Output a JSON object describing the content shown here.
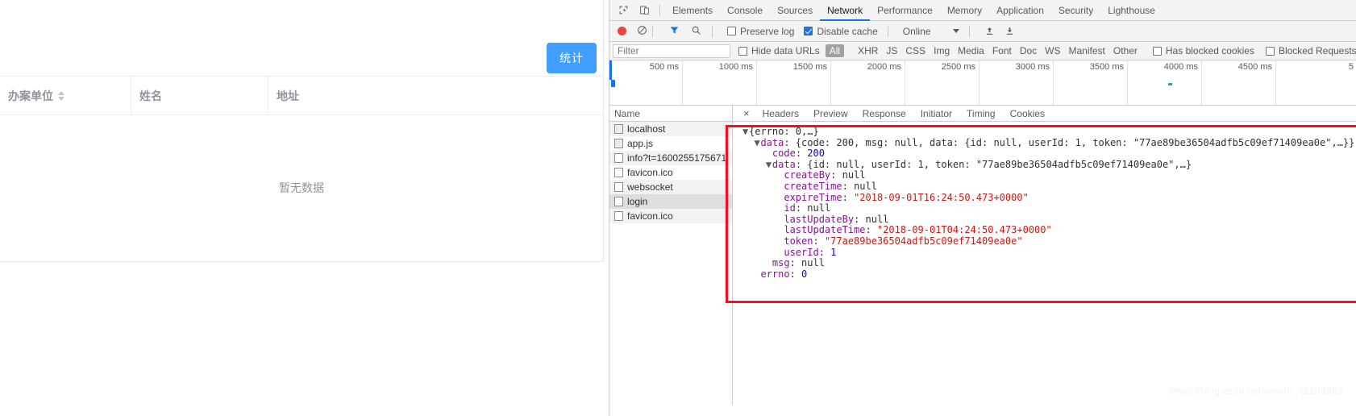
{
  "app": {
    "stat_button": "统计",
    "table": {
      "columns": [
        "办案单位",
        "姓名",
        "地址"
      ],
      "empty_text": "暂无数据"
    }
  },
  "devtools": {
    "tabs": [
      {
        "label": "Elements",
        "active": false
      },
      {
        "label": "Console",
        "active": false
      },
      {
        "label": "Sources",
        "active": false
      },
      {
        "label": "Network",
        "active": true
      },
      {
        "label": "Performance",
        "active": false
      },
      {
        "label": "Memory",
        "active": false
      },
      {
        "label": "Application",
        "active": false
      },
      {
        "label": "Security",
        "active": false
      },
      {
        "label": "Lighthouse",
        "active": false
      }
    ],
    "toolbar": {
      "preserve_log": {
        "label": "Preserve log",
        "checked": false
      },
      "disable_cache": {
        "label": "Disable cache",
        "checked": true
      },
      "throttle": "Online"
    },
    "filterbar": {
      "filter_placeholder": "Filter",
      "filter_value": "",
      "hide_data_urls": {
        "label": "Hide data URLs",
        "checked": false
      },
      "types": [
        "All",
        "XHR",
        "JS",
        "CSS",
        "Img",
        "Media",
        "Font",
        "Doc",
        "WS",
        "Manifest",
        "Other"
      ],
      "selected_type": "All",
      "has_blocked_cookies": {
        "label": "Has blocked cookies",
        "checked": false
      },
      "blocked_requests": {
        "label": "Blocked Requests",
        "checked": false
      }
    },
    "timeline": {
      "ticks": [
        "500 ms",
        "1000 ms",
        "1500 ms",
        "2000 ms",
        "2500 ms",
        "3000 ms",
        "3500 ms",
        "4000 ms",
        "4500 ms",
        "5"
      ]
    },
    "requests": {
      "header": "Name",
      "items": [
        {
          "name": "localhost",
          "selected": false,
          "icon": "document-filled-icon"
        },
        {
          "name": "app.js",
          "selected": false,
          "icon": "document-filled-icon"
        },
        {
          "name": "info?t=1600255175671",
          "selected": false,
          "icon": "document-icon"
        },
        {
          "name": "favicon.ico",
          "selected": false,
          "icon": "document-icon"
        },
        {
          "name": "websocket",
          "selected": false,
          "icon": "document-icon"
        },
        {
          "name": "login",
          "selected": true,
          "icon": "document-icon"
        },
        {
          "name": "favicon.ico",
          "selected": false,
          "icon": "document-icon"
        }
      ]
    },
    "detail": {
      "close_label": "×",
      "tabs": [
        {
          "label": "Headers",
          "active": false
        },
        {
          "label": "Preview",
          "active": true
        },
        {
          "label": "Response",
          "active": false
        },
        {
          "label": "Initiator",
          "active": false
        },
        {
          "label": "Timing",
          "active": false
        },
        {
          "label": "Cookies",
          "active": false
        }
      ],
      "preview_lines": [
        {
          "indent": 0,
          "arrow": "▼",
          "segments": [
            {
              "t": "{errno: 0,…}",
              "c": "plain"
            }
          ]
        },
        {
          "indent": 1,
          "arrow": "▼",
          "segments": [
            {
              "t": "data",
              "c": "k"
            },
            {
              "t": ": {code: 200, msg: null, data: {id: null, userId: 1, token: ",
              "c": "plain"
            },
            {
              "t": "\"77ae89be36504adfb5c09ef71409ea0e\"",
              "c": "plain"
            },
            {
              "t": ",…}}",
              "c": "plain"
            }
          ]
        },
        {
          "indent": 2,
          "arrow": "",
          "segments": [
            {
              "t": "code",
              "c": "k"
            },
            {
              "t": ": ",
              "c": "plain"
            },
            {
              "t": "200",
              "c": "num"
            }
          ]
        },
        {
          "indent": 2,
          "arrow": "▼",
          "segments": [
            {
              "t": "data",
              "c": "k"
            },
            {
              "t": ": {id: null, userId: 1, token: ",
              "c": "plain"
            },
            {
              "t": "\"77ae89be36504adfb5c09ef71409ea0e\"",
              "c": "plain"
            },
            {
              "t": ",…}",
              "c": "plain"
            }
          ]
        },
        {
          "indent": 3,
          "arrow": "",
          "segments": [
            {
              "t": "createBy",
              "c": "k"
            },
            {
              "t": ": ",
              "c": "plain"
            },
            {
              "t": "null",
              "c": "nul"
            }
          ]
        },
        {
          "indent": 3,
          "arrow": "",
          "segments": [
            {
              "t": "createTime",
              "c": "k"
            },
            {
              "t": ": ",
              "c": "plain"
            },
            {
              "t": "null",
              "c": "nul"
            }
          ]
        },
        {
          "indent": 3,
          "arrow": "",
          "segments": [
            {
              "t": "expireTime",
              "c": "k"
            },
            {
              "t": ": ",
              "c": "plain"
            },
            {
              "t": "\"2018-09-01T16:24:50.473+0000\"",
              "c": "str"
            }
          ]
        },
        {
          "indent": 3,
          "arrow": "",
          "segments": [
            {
              "t": "id",
              "c": "k"
            },
            {
              "t": ": ",
              "c": "plain"
            },
            {
              "t": "null",
              "c": "nul"
            }
          ]
        },
        {
          "indent": 3,
          "arrow": "",
          "segments": [
            {
              "t": "lastUpdateBy",
              "c": "k"
            },
            {
              "t": ": ",
              "c": "plain"
            },
            {
              "t": "null",
              "c": "nul"
            }
          ]
        },
        {
          "indent": 3,
          "arrow": "",
          "segments": [
            {
              "t": "lastUpdateTime",
              "c": "k"
            },
            {
              "t": ": ",
              "c": "plain"
            },
            {
              "t": "\"2018-09-01T04:24:50.473+0000\"",
              "c": "str"
            }
          ]
        },
        {
          "indent": 3,
          "arrow": "",
          "segments": [
            {
              "t": "token",
              "c": "k"
            },
            {
              "t": ": ",
              "c": "plain"
            },
            {
              "t": "\"77ae89be36504adfb5c09ef71409ea0e\"",
              "c": "str"
            }
          ]
        },
        {
          "indent": 3,
          "arrow": "",
          "segments": [
            {
              "t": "userId",
              "c": "k"
            },
            {
              "t": ": ",
              "c": "plain"
            },
            {
              "t": "1",
              "c": "num"
            }
          ]
        },
        {
          "indent": 2,
          "arrow": "",
          "segments": [
            {
              "t": "msg",
              "c": "k"
            },
            {
              "t": ": ",
              "c": "plain"
            },
            {
              "t": "null",
              "c": "nul"
            }
          ]
        },
        {
          "indent": 1,
          "arrow": "",
          "segments": [
            {
              "t": "errno",
              "c": "k"
            },
            {
              "t": ": ",
              "c": "plain"
            },
            {
              "t": "0",
              "c": "num"
            }
          ]
        }
      ]
    }
  },
  "watermark": "https://blog.csdn.net/weixin_42103983",
  "colors": {
    "accent": "#409eff",
    "devtools_active_tab": "#1a73e8",
    "record_dot": "#e8453c",
    "highlight_box": "#fc0d1b",
    "json_key": "#881391",
    "json_string": "#c41a16",
    "json_number": "#1c00cf"
  }
}
